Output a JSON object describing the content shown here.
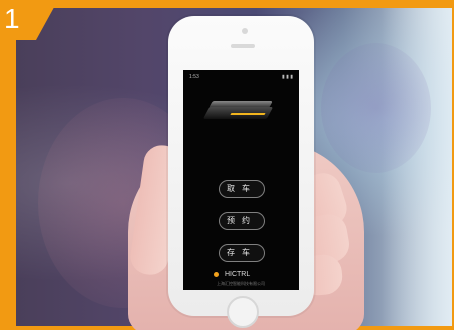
{
  "badge": {
    "number": "1",
    "color": "#f29a12"
  },
  "phone": {
    "status_bar": {
      "time": "1:53",
      "indicators": "▮ ▮ ▮"
    },
    "buttons": [
      "取车",
      "预约",
      "存车"
    ],
    "brand": "HICTRL",
    "company_line": "上海汇控智能科技有限公司"
  },
  "colors": {
    "accent": "#f29a12",
    "brand_dot": "#f2a21d",
    "screen_bg": "#050505"
  }
}
